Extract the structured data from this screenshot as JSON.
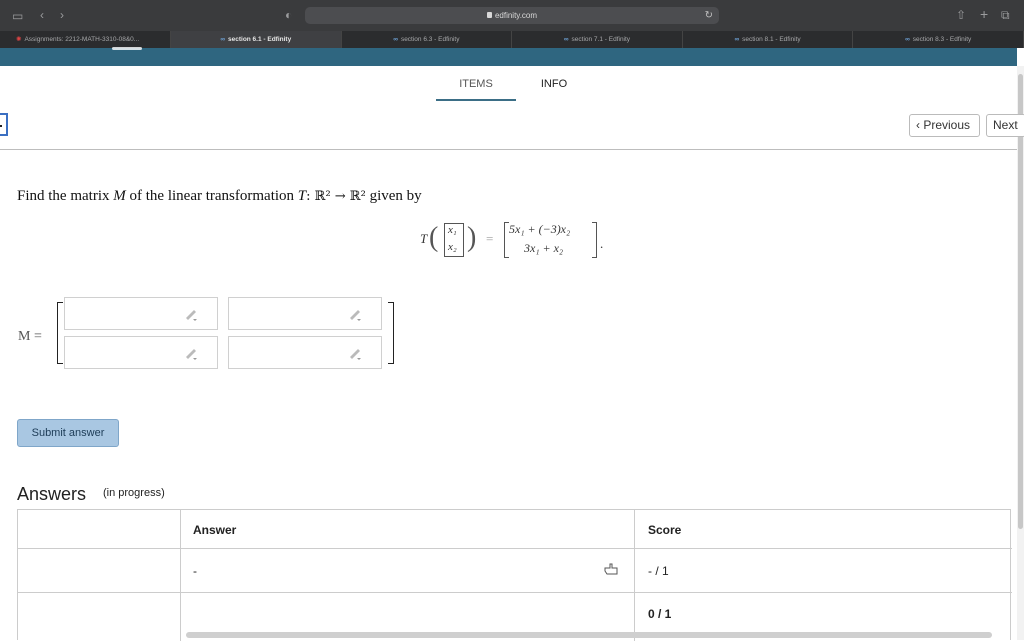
{
  "browser": {
    "address": "edfinity.com",
    "tabs": [
      {
        "label": "Assignments: 2212-MATH-3310-08&0...",
        "active": false
      },
      {
        "label": "section 6.1 - Edfinity",
        "active": true
      },
      {
        "label": "section 6.3 - Edfinity",
        "active": false
      },
      {
        "label": "section 7.1 - Edfinity",
        "active": false
      },
      {
        "label": "section 8.1 - Edfinity",
        "active": false
      },
      {
        "label": "section 8.3 - Edfinity",
        "active": false
      }
    ]
  },
  "page": {
    "tab_items": "ITEMS",
    "tab_info": "INFO",
    "prev_label": "Previous",
    "next_label": "Next"
  },
  "problem": {
    "text_find": "Find the matrix",
    "var_M": "M",
    "text_of": "of the linear transformation",
    "var_T": "T",
    "map": ": ℝ² → ℝ²",
    "text_given": "given by",
    "input_x1": "x₁",
    "input_x2": "x₂",
    "output_row1": "5x₁ + (−3)x₂",
    "output_row2": "3x₁ + x₂",
    "eq": "=",
    "period": ".",
    "matrix_label": "M ="
  },
  "matrix_inputs": [
    "",
    "",
    "",
    ""
  ],
  "submit_label": "Submit answer",
  "answers": {
    "title": "Answers",
    "subtitle": "(in progress)",
    "headers": {
      "answer": "Answer",
      "score": "Score"
    },
    "rows": [
      {
        "answer": "-",
        "score": "- / 1"
      },
      {
        "answer": "",
        "score": "0 / 1"
      }
    ]
  }
}
